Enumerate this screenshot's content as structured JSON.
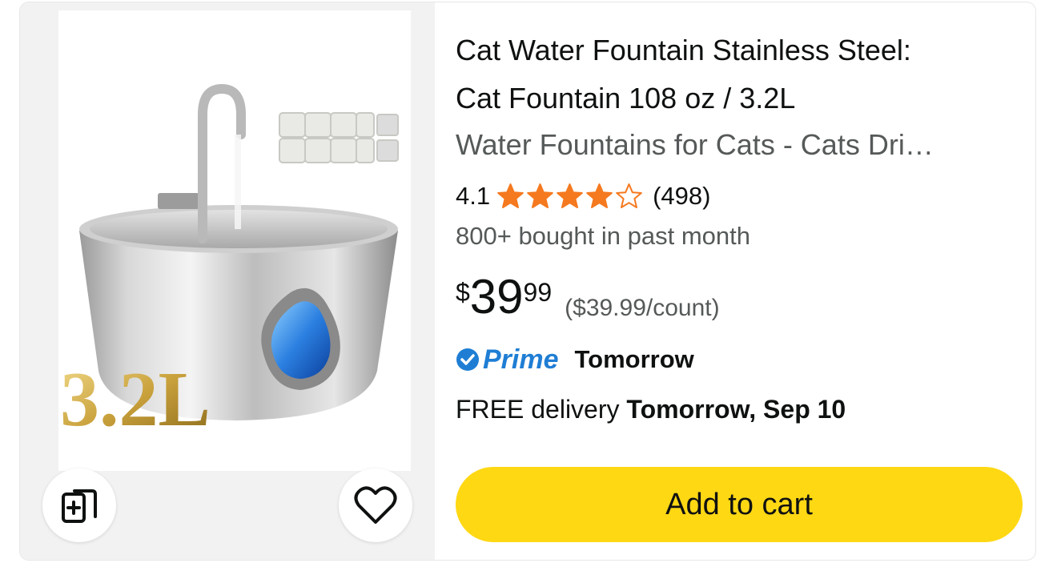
{
  "product": {
    "title_line1": "Cat Water Fountain Stainless Steel:",
    "title_line2": "Cat Fountain 108 oz / 3.2L",
    "subtitle": "Water Fountains for Cats - Cats Dri…",
    "image_badge_text": "3.2L",
    "rating": {
      "value": "4.1",
      "stars": 4.1,
      "max_stars": 5,
      "count": "(498)",
      "star_color": "#f5791f"
    },
    "bought_text": "800+ bought in past month",
    "price": {
      "currency": "$",
      "whole": "39",
      "fraction": "99",
      "unit_price": "($39.99/count)"
    },
    "prime": {
      "label": "Prime",
      "delivery_label": "Tomorrow",
      "color": "#1f7ed4"
    },
    "delivery": {
      "prefix": "FREE delivery",
      "date": "Tomorrow, Sep 10"
    },
    "add_to_cart_label": "Add to cart",
    "add_to_cart_color": "#ffd814"
  },
  "icons": {
    "compare": "compare-cards-icon",
    "wishlist": "heart-icon"
  }
}
